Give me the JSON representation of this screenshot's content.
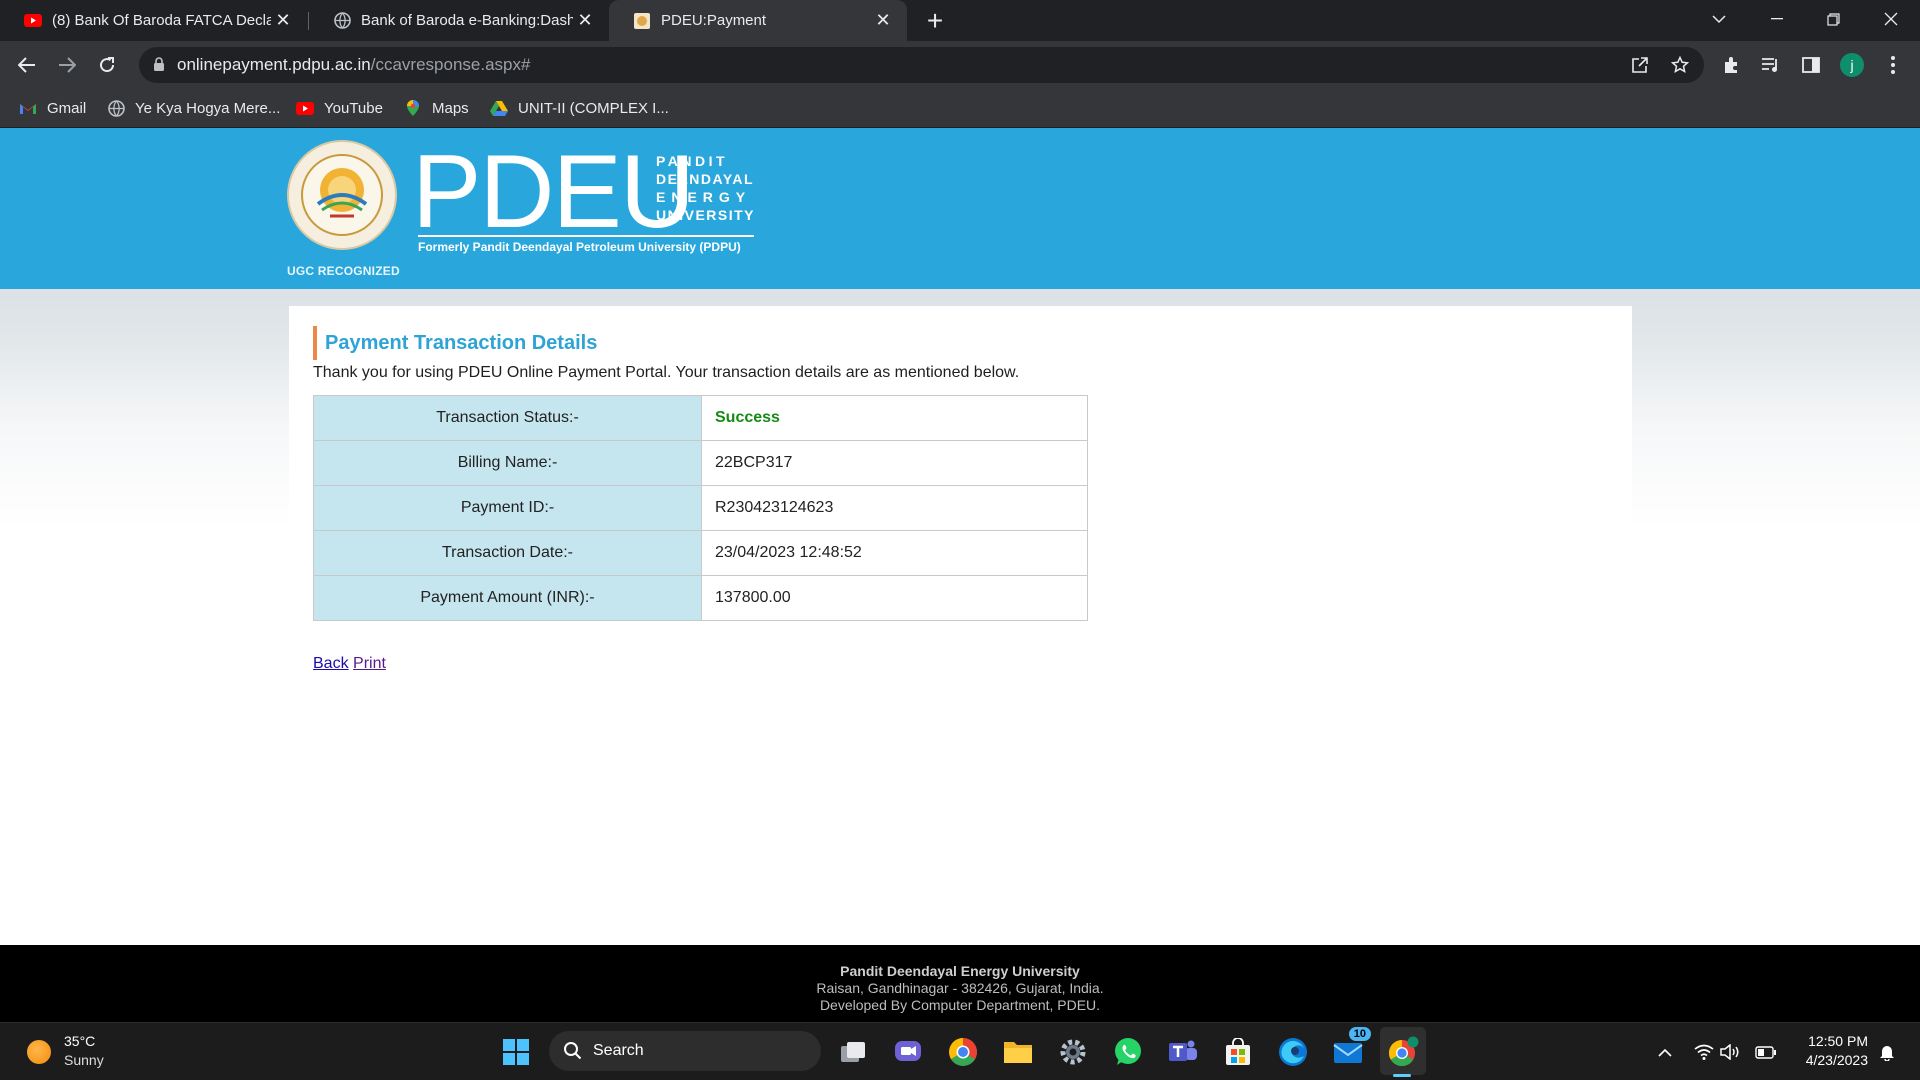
{
  "browser": {
    "tabs": [
      {
        "title": "(8) Bank Of Baroda FATCA Declar",
        "favicon": "youtube-icon",
        "active": false
      },
      {
        "title": "Bank of Baroda e-Banking:Dashb",
        "favicon": "globe-icon",
        "active": false
      },
      {
        "title": "PDEU:Payment",
        "favicon": "pdeu-favicon",
        "active": true
      }
    ],
    "address": {
      "host": "onlinepayment.pdpu.ac.in",
      "path": "/ccavresponse.aspx#"
    },
    "profile_initial": "j",
    "bookmarks": [
      {
        "label": "Gmail",
        "icon": "gmail-icon"
      },
      {
        "label": "Ye Kya Hogya Mere...",
        "icon": "globe-icon"
      },
      {
        "label": "YouTube",
        "icon": "youtube-icon"
      },
      {
        "label": "Maps",
        "icon": "maps-icon"
      },
      {
        "label": "UNIT-II (COMPLEX I...",
        "icon": "google-drive-icon"
      }
    ]
  },
  "site": {
    "brand": {
      "acronym": "PDEU",
      "name_lines": [
        "PANDIT",
        "DEENDAYAL",
        "ENERGY",
        "UNIVERSITY"
      ],
      "formerly": "Formerly Pandit Deendayal Petroleum University (PDPU)",
      "ugc": "UGC RECOGNIZED"
    },
    "heading": "Payment Transaction Details",
    "intro": "Thank you for using PDEU Online Payment Portal. Your transaction details are as mentioned below.",
    "details": [
      {
        "label": "Transaction Status:-",
        "value": "Success"
      },
      {
        "label": "Billing Name:-",
        "value": "22BCP317"
      },
      {
        "label": "Payment ID:-",
        "value": "R230423124623"
      },
      {
        "label": "Transaction Date:-",
        "value": "23/04/2023 12:48:52"
      },
      {
        "label": "Payment Amount (INR):-",
        "value": "137800.00"
      }
    ],
    "links": {
      "back": "Back",
      "print": "Print"
    },
    "footer": {
      "line1": "Pandit Deendayal Energy University",
      "line2": "Raisan, Gandhinagar - 382426, Gujarat, India.",
      "line3": "Developed By Computer Department, PDEU."
    },
    "colors": {
      "banner": "#29a7dc",
      "heading": "#2ea3d6",
      "accent_bar": "#f0874a",
      "success": "#178a16",
      "label_cell": "#c6e6ef"
    }
  },
  "taskbar": {
    "weather": {
      "temp": "35°C",
      "condition": "Sunny"
    },
    "search_label": "Search",
    "mail_badge": "10",
    "clock": {
      "time": "12:50 PM",
      "date": "4/23/2023"
    }
  }
}
